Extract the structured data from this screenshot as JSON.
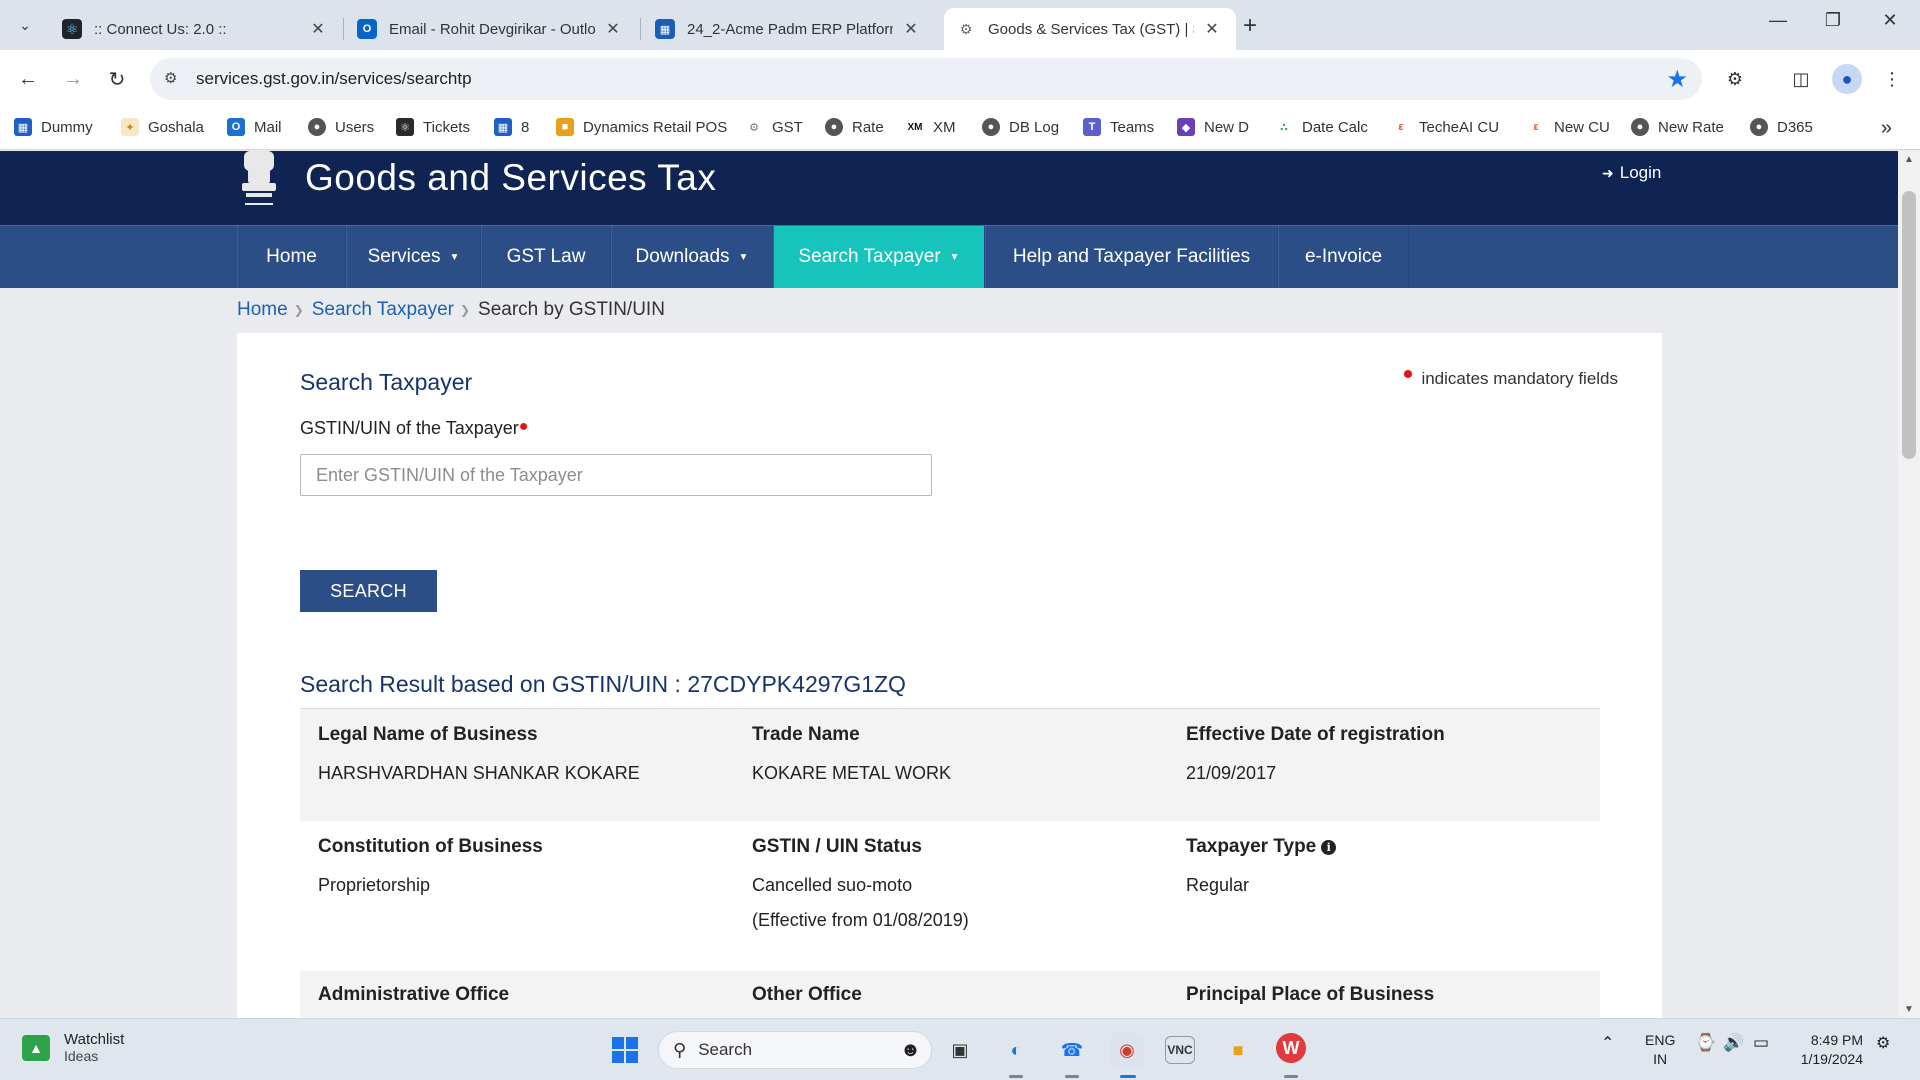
{
  "browser": {
    "tabs": [
      {
        "title": ":: Connect Us: 2.0 ::",
        "icon": "react-atom-icon"
      },
      {
        "title": "Email - Rohit Devgirikar - Outlo",
        "icon": "outlook-icon"
      },
      {
        "title": "24_2-Acme Padm ERP Platform",
        "icon": "devops-icon"
      },
      {
        "title": "Goods & Services Tax (GST) | Se",
        "icon": "gst-emblem-icon"
      }
    ],
    "url": "services.gst.gov.in/services/searchtp",
    "bookmarks": [
      {
        "label": "Dummy",
        "color": "#1f5fbf"
      },
      {
        "label": "Goshala",
        "color": "#f4a623"
      },
      {
        "label": "Mail",
        "color": "#1f6fd0"
      },
      {
        "label": "Users",
        "color": "#555555"
      },
      {
        "label": "Tickets",
        "color": "#2b2b2b"
      },
      {
        "label": "8",
        "color": "#1f5fbf"
      },
      {
        "label": "Dynamics Retail POS",
        "color": "#e8a21a"
      },
      {
        "label": "GST",
        "color": "#777777"
      },
      {
        "label": "Rate",
        "color": "#555555"
      },
      {
        "label": "XM",
        "color": "#111111"
      },
      {
        "label": "DB Log",
        "color": "#555555"
      },
      {
        "label": "Teams",
        "color": "#5b5fc7"
      },
      {
        "label": "New D",
        "color": "#6b3fb8"
      },
      {
        "label": "Date Calc",
        "color": "#2aa84a"
      },
      {
        "label": "TecheAI CU",
        "color": "#e05a2a"
      },
      {
        "label": "New CU",
        "color": "#e05a2a"
      },
      {
        "label": "New Rate",
        "color": "#555555"
      },
      {
        "label": "D365",
        "color": "#555555"
      }
    ]
  },
  "site": {
    "title": "Goods and Services Tax",
    "login": "Login",
    "nav": [
      {
        "label": "Home",
        "caret": false
      },
      {
        "label": "Services",
        "caret": true
      },
      {
        "label": "GST Law",
        "caret": false
      },
      {
        "label": "Downloads",
        "caret": true
      },
      {
        "label": "Search Taxpayer",
        "caret": true,
        "active": true
      },
      {
        "label": "Help and Taxpayer Facilities",
        "caret": false
      },
      {
        "label": "e-Invoice",
        "caret": false
      }
    ],
    "breadcrumb": {
      "home": "Home",
      "section": "Search Taxpayer",
      "current": "Search by GSTIN/UIN"
    }
  },
  "form": {
    "title": "Search Taxpayer",
    "mandatory_note": "indicates mandatory fields",
    "field_label": "GSTIN/UIN of the Taxpayer",
    "placeholder": "Enter GSTIN/UIN of the Taxpayer",
    "button": "SEARCH"
  },
  "result": {
    "title": "Search Result based on GSTIN/UIN : 27CDYPK4297G1ZQ",
    "legal_name_label": "Legal Name of Business",
    "legal_name": "HARSHVARDHAN SHANKAR KOKARE",
    "trade_name_label": "Trade Name",
    "trade_name": "KOKARE METAL WORK",
    "eff_date_label": "Effective Date of registration",
    "eff_date": "21/09/2017",
    "constitution_label": "Constitution of Business",
    "constitution": "Proprietorship",
    "status_label": "GSTIN / UIN Status",
    "status": "Cancelled suo-moto",
    "status_effective": "(Effective from 01/08/2019)",
    "taxpayer_type_label": "Taxpayer Type",
    "taxpayer_type": "Regular",
    "admin_office_label": "Administrative Office",
    "other_office_label": "Other Office",
    "principal_place_label": "Principal Place of Business"
  },
  "taskbar": {
    "widget_title": "Watchlist",
    "widget_sub": "Ideas",
    "search": "Search",
    "lang1": "ENG",
    "lang2": "IN",
    "time": "8:49 PM",
    "date": "1/19/2024"
  }
}
